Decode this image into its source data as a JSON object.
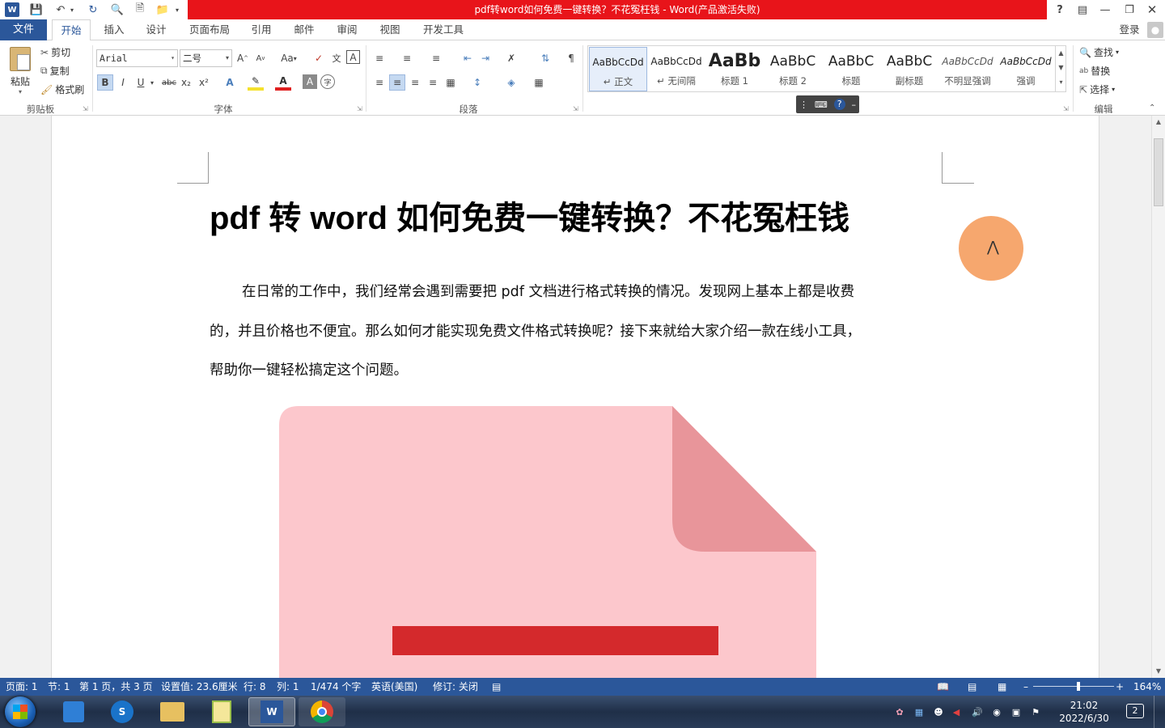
{
  "window": {
    "title": "pdf转word如何免费一键转换？不花冤枉钱 - Word(产品激活失败)",
    "help": "?",
    "colors": {
      "accent": "#2b579a",
      "title_bar_bg": "#e8141a"
    }
  },
  "tabs": {
    "file": "文件",
    "items": [
      "开始",
      "插入",
      "设计",
      "页面布局",
      "引用",
      "邮件",
      "审阅",
      "视图",
      "开发工具"
    ],
    "active": "开始",
    "login": "登录"
  },
  "ribbon": {
    "clipboard": {
      "paste": "粘贴",
      "cut": "剪切",
      "copy": "复制",
      "format_painter": "格式刷",
      "label": "剪贴板"
    },
    "font": {
      "name": "Arial",
      "size": "二号",
      "bold": "B",
      "italic": "I",
      "underline": "U",
      "strike": "abc",
      "sub": "x₂",
      "sup": "x²",
      "aa": "Aa",
      "label": "字体"
    },
    "paragraph": {
      "label": "段落"
    },
    "styles": {
      "items": [
        {
          "sample": "AaBbCcDd",
          "label": "↵ 正文"
        },
        {
          "sample": "AaBbCcDd",
          "label": "↵ 无间隔"
        },
        {
          "sample": "AaBb",
          "label": "标题 1"
        },
        {
          "sample": "AaBbC",
          "label": "标题 2"
        },
        {
          "sample": "AaBbC",
          "label": "标题"
        },
        {
          "sample": "AaBbC",
          "label": "副标题"
        },
        {
          "sample": "AaBbCcDd",
          "label": "不明显强调"
        },
        {
          "sample": "AaBbCcDd",
          "label": "强调"
        }
      ]
    },
    "editing": {
      "find": "查找",
      "replace": "替换",
      "select": "选择",
      "label": "编辑"
    }
  },
  "document": {
    "heading": "pdf 转 word 如何免费一键转换？不花冤枉钱",
    "paragraph_lines": [
      "在日常的工作中，我们经常会遇到需要把 pdf 文档进行格式转换的情况。发现网上基本上都是收费",
      "的，并且价格也不便宜。那么如何才能实现免费文件格式转换呢？接下来就给大家介绍一款在线小工具，",
      "帮助你一键轻松搞定这个问题。"
    ]
  },
  "status": {
    "page": "页面: 1",
    "section": "节: 1",
    "pages": "第 1 页，共 3 页",
    "position": "设置值: 23.6厘米",
    "row": "行: 8",
    "col": "列: 1",
    "words": "1/474 个字",
    "lang": "英语(美国)",
    "track": "修订: 关闭",
    "zoom": "164%"
  },
  "taskbar": {
    "time": "21:02",
    "date": "2022/6/30",
    "notifications": "2"
  }
}
